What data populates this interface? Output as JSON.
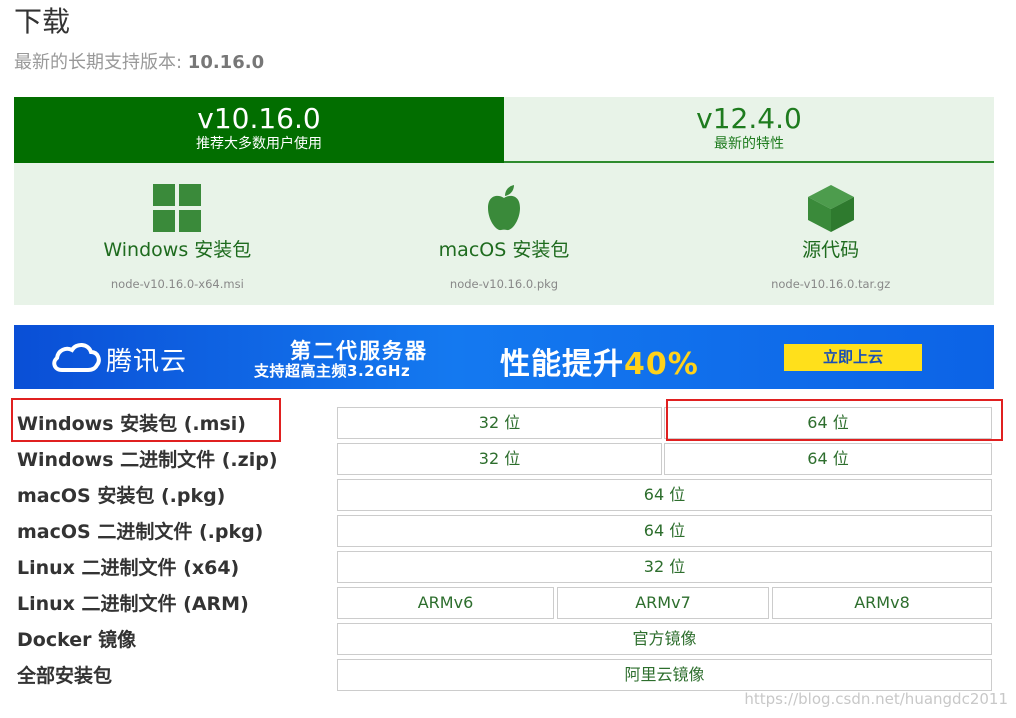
{
  "header": {
    "title": "下载",
    "lts_prefix": "最新的长期支持版本: ",
    "lts_version": "10.16.0"
  },
  "tabs": [
    {
      "version": "v10.16.0",
      "description": "推荐大多数用户使用"
    },
    {
      "version": "v12.4.0",
      "description": "最新的特性"
    }
  ],
  "installers": [
    {
      "icon": "windows-icon",
      "label": "Windows 安装包",
      "file": "node-v10.16.0-x64.msi"
    },
    {
      "icon": "apple-icon",
      "label": "macOS 安装包",
      "file": "node-v10.16.0.pkg"
    },
    {
      "icon": "source-code-box-icon",
      "label": "源代码",
      "file": "node-v10.16.0.tar.gz"
    }
  ],
  "banner": {
    "brand": "腾讯云",
    "line1": "第二代服务器",
    "line2": "支持超高主频3.2GHz",
    "perf_text": "性能提升",
    "perf_pct": "40%",
    "cta": "立即上云"
  },
  "downloads": {
    "rows": [
      {
        "label": "Windows 安装包 (.msi)",
        "options": [
          "32 位",
          "64 位"
        ]
      },
      {
        "label": "Windows 二进制文件 (.zip)",
        "options": [
          "32 位",
          "64 位"
        ]
      },
      {
        "label": "macOS 安装包 (.pkg)",
        "options": [
          "64 位"
        ]
      },
      {
        "label": "macOS 二进制文件 (.pkg)",
        "options": [
          "64 位"
        ]
      },
      {
        "label": "Linux 二进制文件 (x64)",
        "options": [
          "32 位"
        ]
      },
      {
        "label": "Linux 二进制文件 (ARM)",
        "options": [
          "ARMv6",
          "ARMv7",
          "ARMv8"
        ]
      },
      {
        "label": "Docker 镜像",
        "options": [
          "官方镜像"
        ]
      },
      {
        "label": "全部安装包",
        "options": [
          "阿里云镜像"
        ]
      }
    ]
  },
  "watermark": "https://blog.csdn.net/huangdc2011",
  "colors": {
    "brand_green": "#026e00",
    "light_green_bg": "#e8f3e8",
    "link_green": "#2d6e2d",
    "highlight_red": "#e02020",
    "banner_blue": "#1479f0"
  }
}
